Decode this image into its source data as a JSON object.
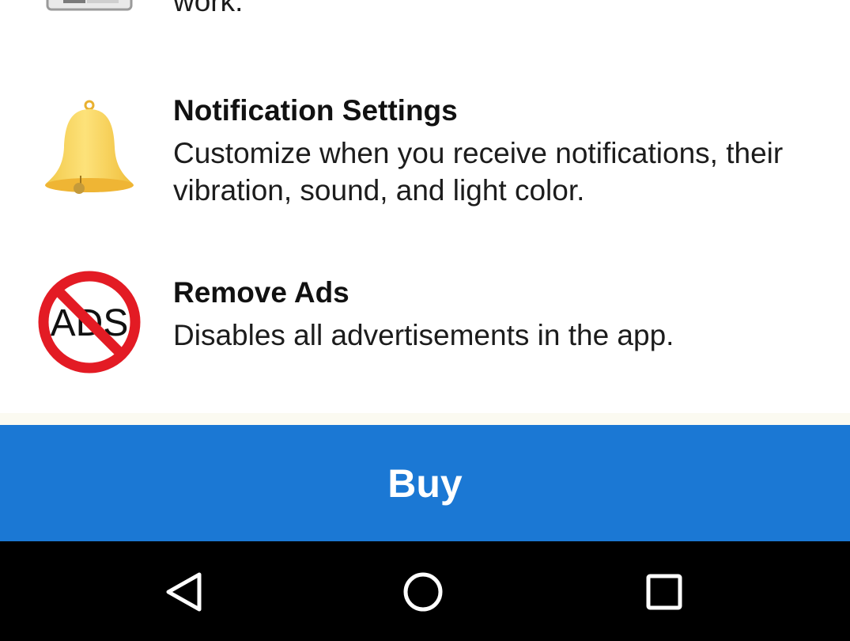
{
  "features": [
    {
      "icon": "settings-window-icon",
      "title": "",
      "description": "work."
    },
    {
      "icon": "bell-icon",
      "title": "Notification Settings",
      "description": "Customize when you receive notifications, their vibration, sound, and light color."
    },
    {
      "icon": "no-ads-icon",
      "title": "Remove Ads",
      "description": "Disables all advertisements in the app."
    }
  ],
  "buy_button": {
    "label": "Buy",
    "color": "#1b78d4"
  },
  "nav_bar": {
    "back_icon": "triangle-back-icon",
    "home_icon": "circle-home-icon",
    "recents_icon": "square-recents-icon"
  }
}
